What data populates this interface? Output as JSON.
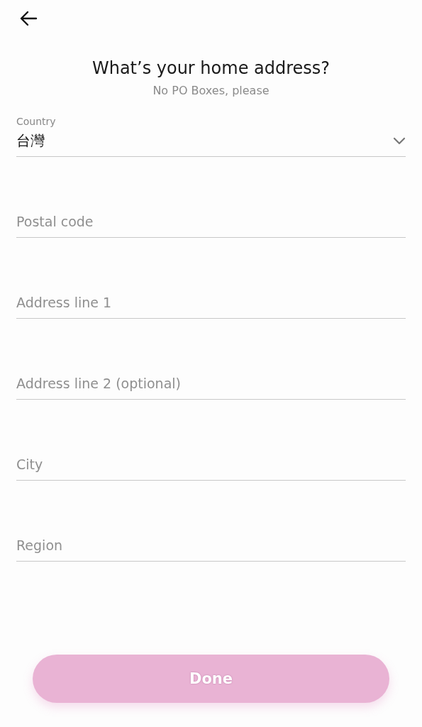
{
  "title": "What’s your home address?",
  "subtitle": "No PO Boxes, please",
  "fields": [
    {
      "kind": "select",
      "label": "Country",
      "value": "台灣"
    },
    {
      "kind": "text",
      "placeholder": "Postal code"
    },
    {
      "kind": "text",
      "placeholder": "Address line 1"
    },
    {
      "kind": "text",
      "placeholder": "Address line 2 (optional)"
    },
    {
      "kind": "text",
      "placeholder": "City"
    },
    {
      "kind": "text",
      "placeholder": "Region"
    }
  ],
  "done_button": {
    "label": "Done",
    "disabled": true
  }
}
